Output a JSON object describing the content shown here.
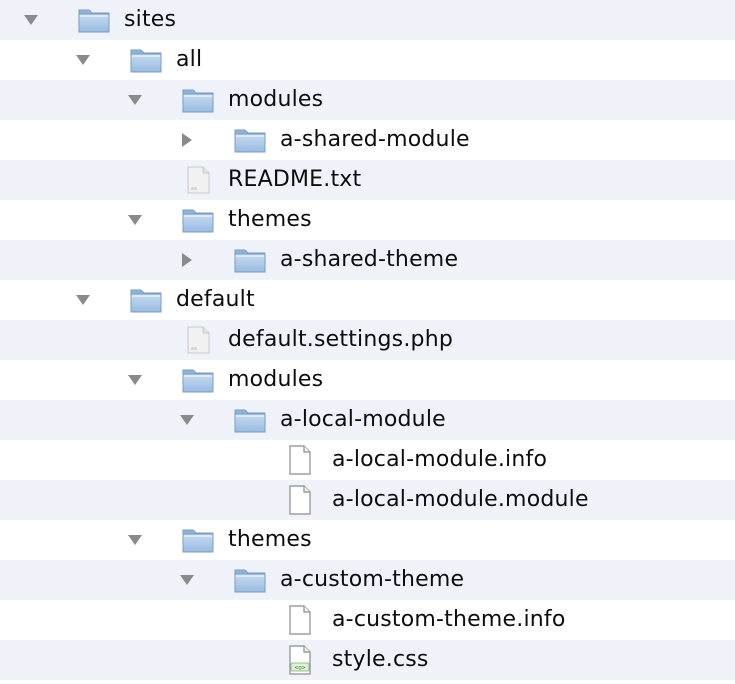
{
  "tree": {
    "rows": [
      {
        "name": "sites",
        "kind": "folder",
        "depth": 0,
        "expanded": true
      },
      {
        "name": "all",
        "kind": "folder",
        "depth": 1,
        "expanded": true
      },
      {
        "name": "modules",
        "kind": "folder",
        "depth": 2,
        "expanded": true
      },
      {
        "name": "a-shared-module",
        "kind": "folder",
        "depth": 3,
        "expanded": false
      },
      {
        "name": "README.txt",
        "kind": "text-file",
        "depth": 2
      },
      {
        "name": "themes",
        "kind": "folder",
        "depth": 2,
        "expanded": true
      },
      {
        "name": "a-shared-theme",
        "kind": "folder",
        "depth": 3,
        "expanded": false
      },
      {
        "name": "default",
        "kind": "folder",
        "depth": 1,
        "expanded": true
      },
      {
        "name": "default.settings.php",
        "kind": "text-file",
        "depth": 2
      },
      {
        "name": "modules",
        "kind": "folder",
        "depth": 2,
        "expanded": true
      },
      {
        "name": "a-local-module",
        "kind": "folder",
        "depth": 3,
        "expanded": true
      },
      {
        "name": "a-local-module.info",
        "kind": "document",
        "depth": 4
      },
      {
        "name": "a-local-module.module",
        "kind": "document",
        "depth": 4
      },
      {
        "name": "themes",
        "kind": "folder",
        "depth": 2,
        "expanded": true
      },
      {
        "name": "a-custom-theme",
        "kind": "folder",
        "depth": 3,
        "expanded": true
      },
      {
        "name": "a-custom-theme.info",
        "kind": "document",
        "depth": 4
      },
      {
        "name": "style.css",
        "kind": "css-file",
        "depth": 4
      }
    ]
  },
  "colors": {
    "stripe": "#eff2f8",
    "text": "#0d0d0d",
    "disclosure": "#8a8a8a",
    "folder_body": "#a9c8e8",
    "folder_tab": "#8fb3da"
  }
}
